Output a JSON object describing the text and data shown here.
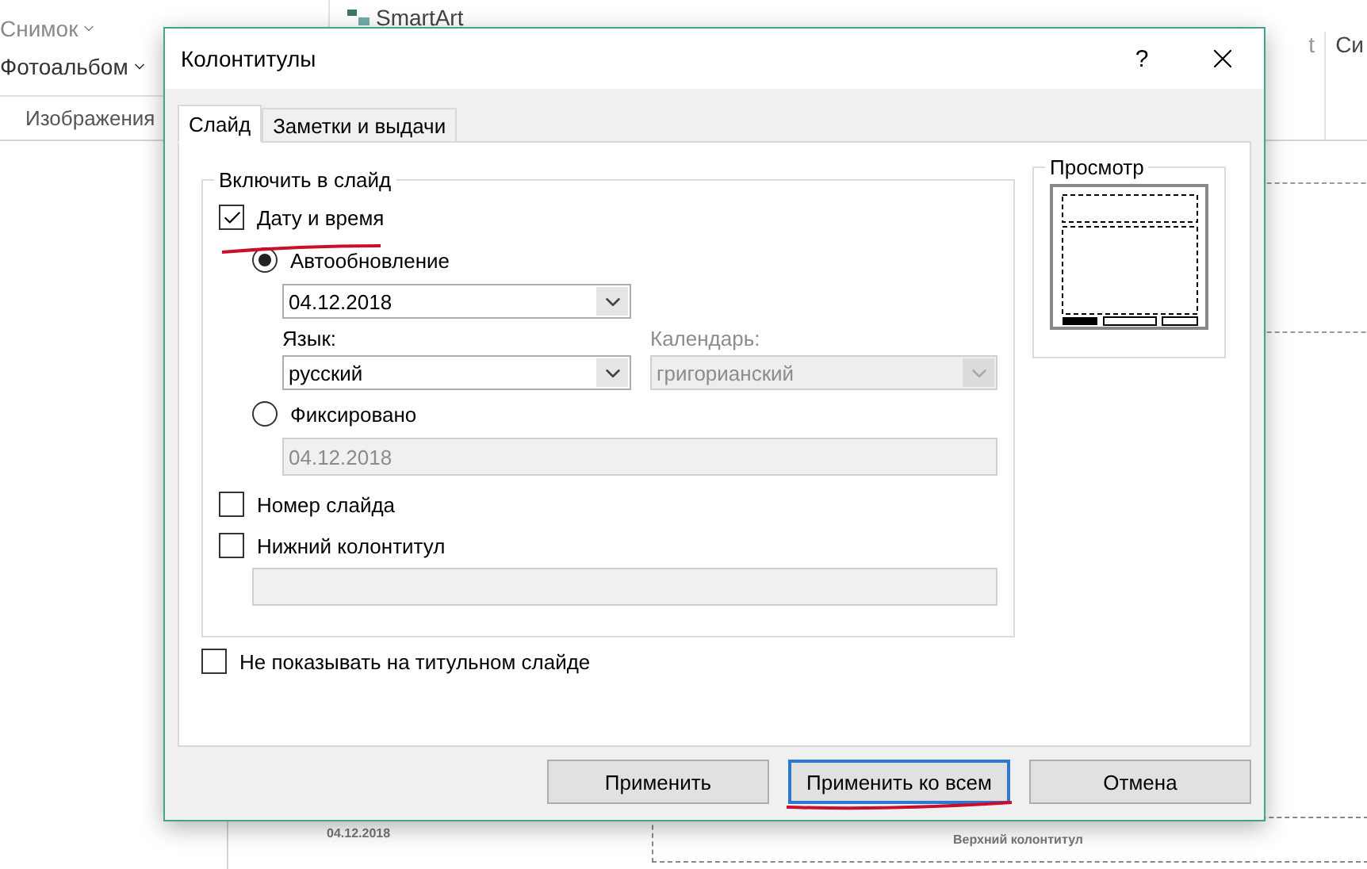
{
  "ribbon": {
    "left_items": [
      {
        "label": "Снимок",
        "disabled": true
      },
      {
        "label": "Фотоальбом",
        "disabled": false
      }
    ],
    "group_label": "Изображения",
    "smartart": "SmartArt",
    "cut_label": "t",
    "right_label": "Си"
  },
  "slide": {
    "date_text": "04.12.2018",
    "header_placeholder": "Верхний колонтитул"
  },
  "dialog": {
    "title": "Колонтитулы",
    "help": "?",
    "tabs": [
      {
        "label": "Слайд",
        "selected": true
      },
      {
        "label": "Заметки и выдачи",
        "selected": false
      }
    ],
    "include_group": {
      "title": "Включить в слайд",
      "date_time": {
        "label": "Дату и время",
        "checked": true
      },
      "auto_update": {
        "label": "Автообновление",
        "selected": true,
        "value": "04.12.2018"
      },
      "language": {
        "label": "Язык:",
        "value": "русский",
        "disabled": false
      },
      "calendar": {
        "label": "Календарь:",
        "value": "григорианский",
        "disabled": true
      },
      "fixed": {
        "label": "Фиксировано",
        "selected": false,
        "value": "04.12.2018",
        "disabled": true
      },
      "slide_number": {
        "label": "Номер слайда",
        "checked": false
      },
      "footer": {
        "label": "Нижний колонтитул",
        "checked": false,
        "disabled": true
      }
    },
    "hide_on_title": {
      "label": "Не показывать на титульном слайде",
      "checked": false
    },
    "preview": {
      "title": "Просмотр"
    },
    "buttons": [
      {
        "label": "Применить",
        "default": false
      },
      {
        "label": "Применить ко всем",
        "default": true
      },
      {
        "label": "Отмена",
        "default": false
      }
    ]
  }
}
